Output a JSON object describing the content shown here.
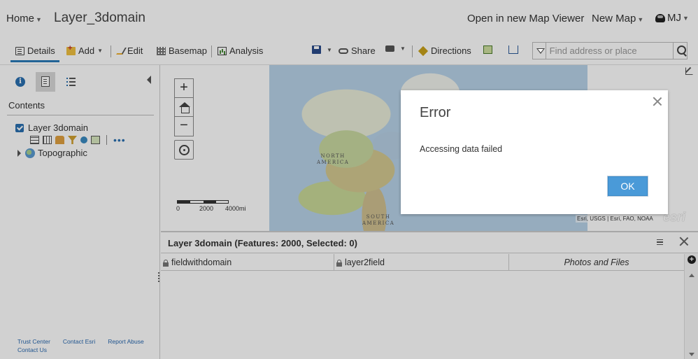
{
  "header": {
    "home_label": "Home",
    "map_title": "Layer_3domain",
    "open_viewer": "Open in new Map Viewer",
    "new_map": "New Map",
    "user_initials": "MJ"
  },
  "toolbar": {
    "details": "Details",
    "add": "Add",
    "edit": "Edit",
    "basemap": "Basemap",
    "analysis": "Analysis",
    "share": "Share",
    "directions": "Directions",
    "search_placeholder": "Find address or place"
  },
  "left_panel": {
    "heading": "Contents",
    "layer_name": "Layer 3domain",
    "basemap_name": "Topographic",
    "footer": {
      "trust": "Trust Center",
      "contact_esri": "Contact Esri",
      "report": "Report Abuse",
      "contact_us": "Contact Us"
    }
  },
  "map": {
    "label_na_1": "NORTH",
    "label_na_2": "AMERICA",
    "label_sa_1": "SOUTH",
    "label_sa_2": "AMERICA",
    "scale_0": "0",
    "scale_mid": "2000",
    "scale_max": "4000mi",
    "attribution": "Esri, USGS | Esri, FAO, NOAA",
    "logo": "esri"
  },
  "attribute_table": {
    "title": "Layer 3domain (Features: 2000, Selected: 0)",
    "columns": [
      "fieldwithdomain",
      "layer2field",
      "Photos and Files"
    ]
  },
  "dialog": {
    "title": "Error",
    "message": "Accessing data failed",
    "ok_label": "OK"
  },
  "colors": {
    "accent": "#2a7ab8",
    "ok_button": "#4a9ad8"
  }
}
